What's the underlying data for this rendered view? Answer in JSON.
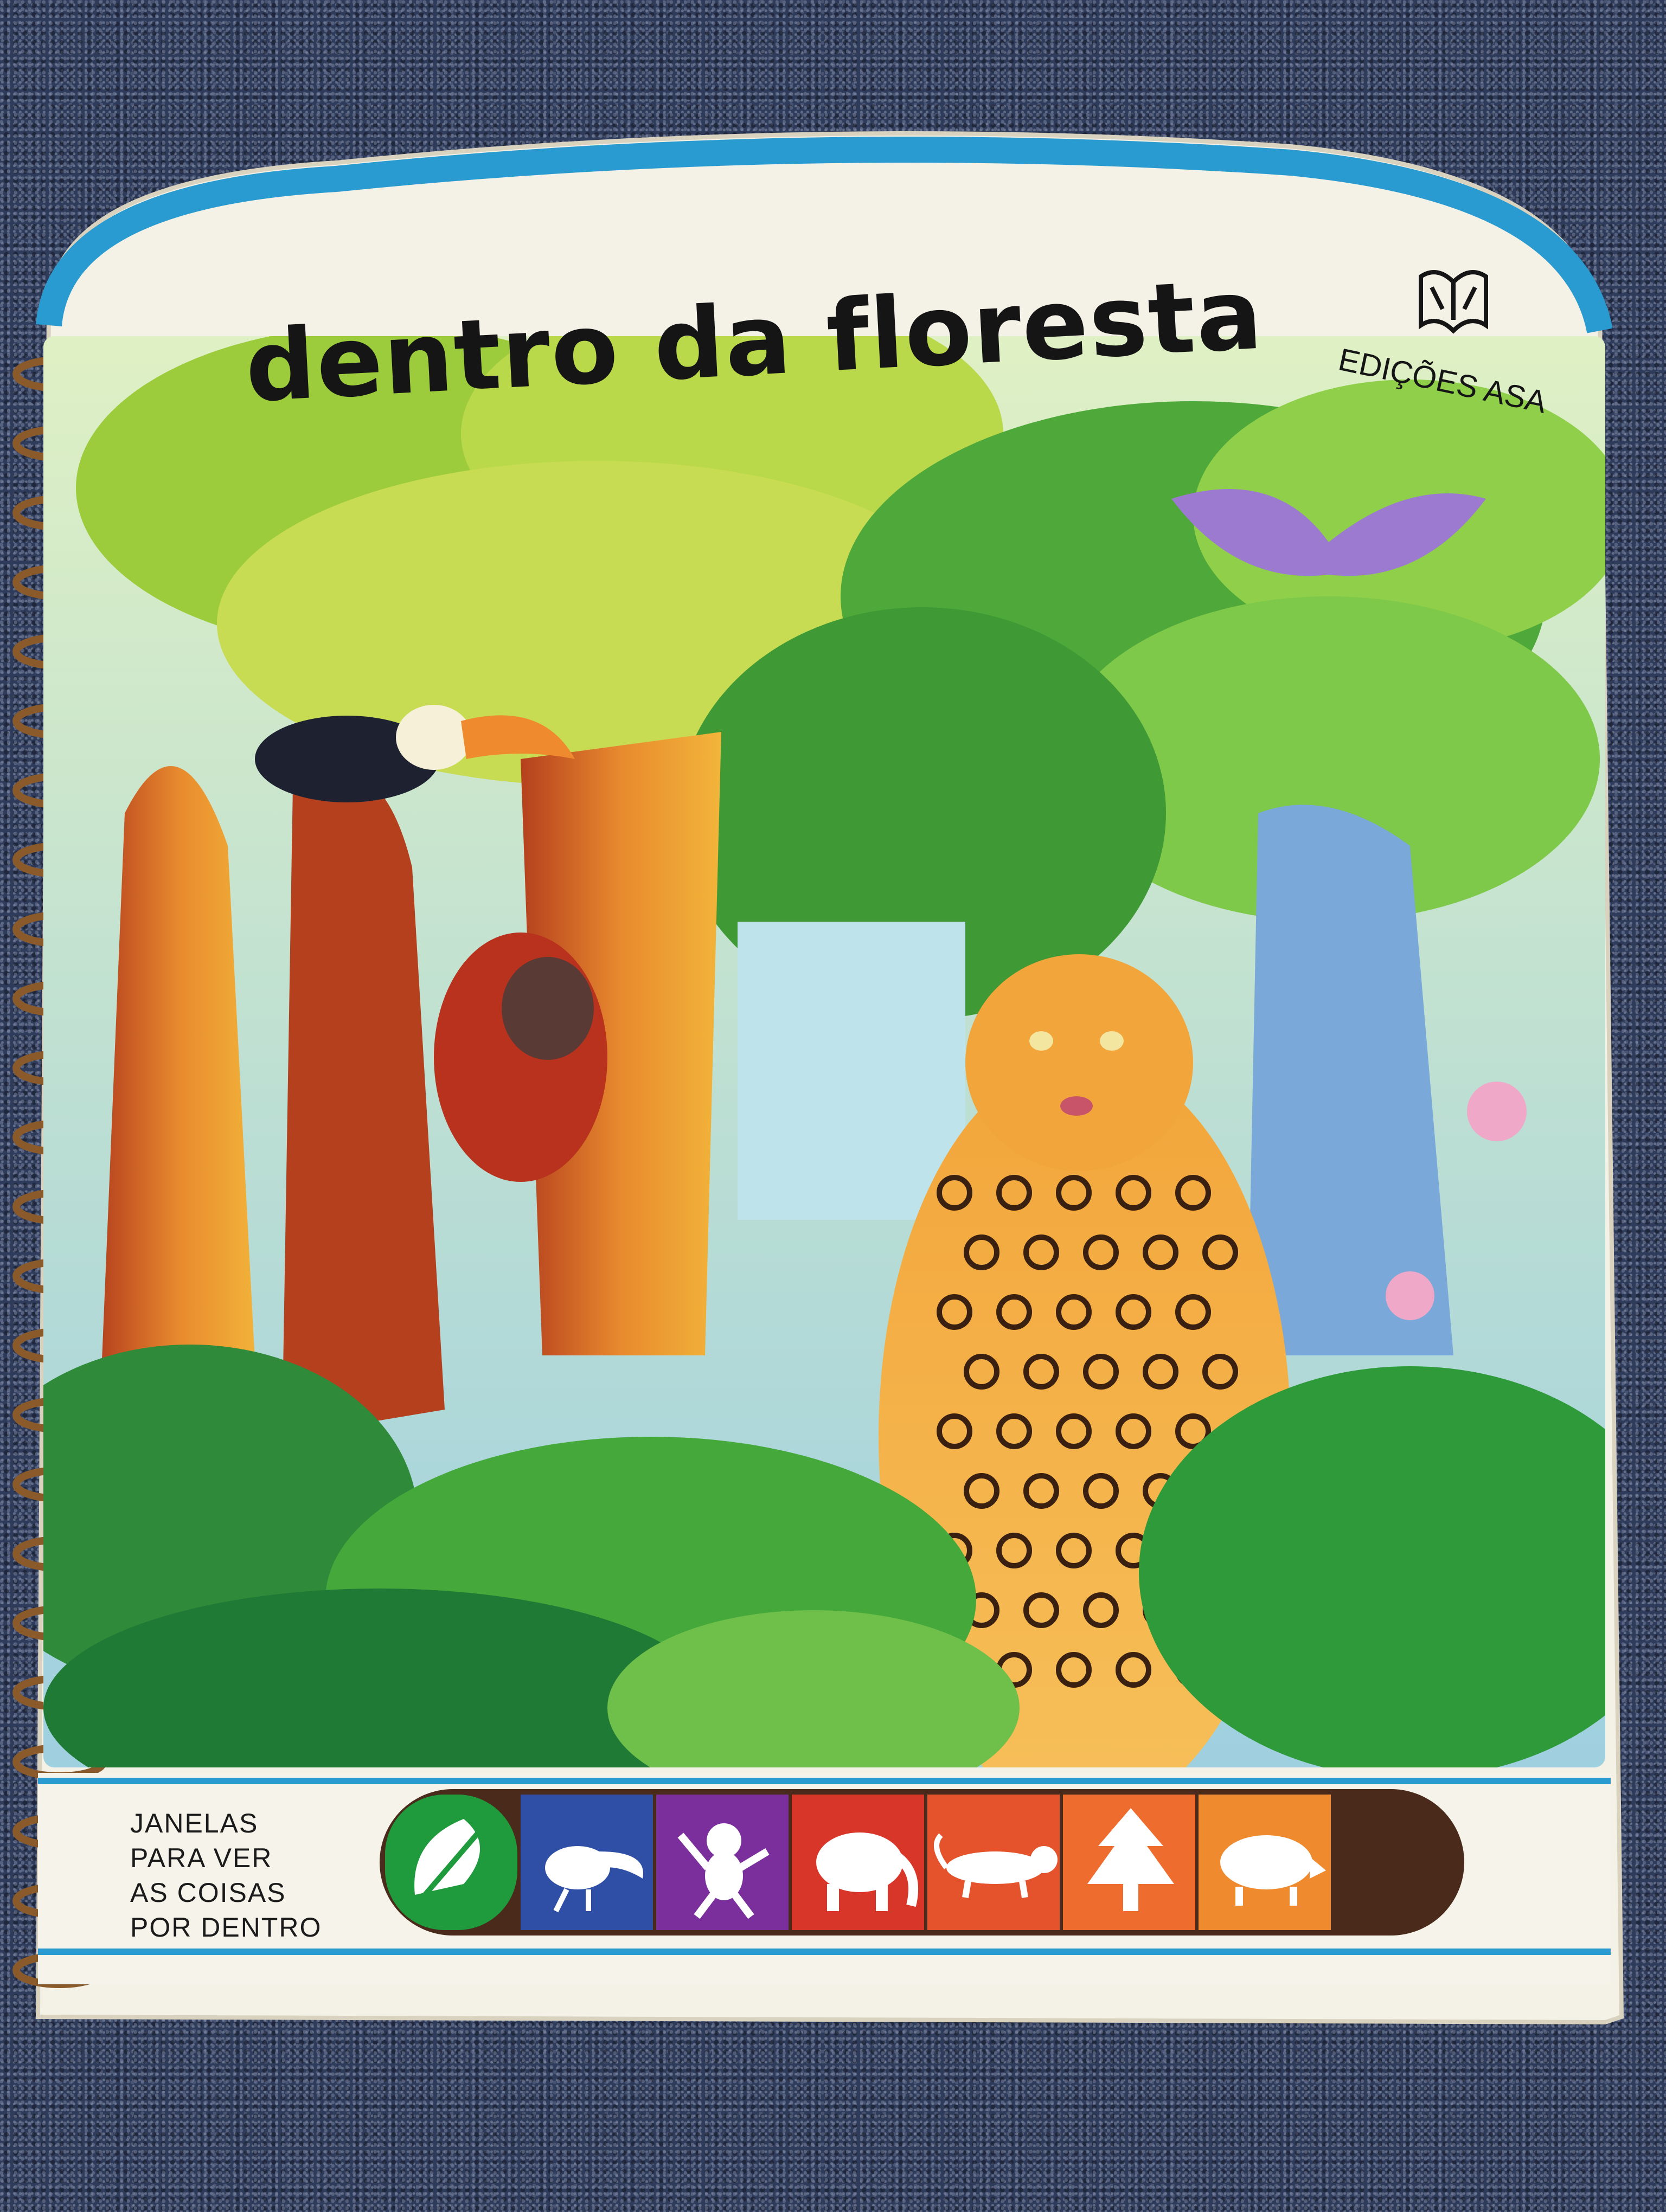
{
  "cover": {
    "title": "dentro da floresta",
    "publisher": "EDIÇÕES ASA",
    "tagline_lines": [
      "JANELAS",
      "PARA VER",
      "AS COISAS",
      "POR DENTRO"
    ]
  },
  "tabs": [
    {
      "icon": "leaf-icon",
      "color": "#1f9a3c"
    },
    {
      "icon": "toucan-icon",
      "color": "#2f4fa6"
    },
    {
      "icon": "monkey-icon",
      "color": "#7a2f9c"
    },
    {
      "icon": "elephant-icon",
      "color": "#d9362a"
    },
    {
      "icon": "tiger-icon",
      "color": "#e4532b"
    },
    {
      "icon": "tree-icon",
      "color": "#ee6c2d"
    },
    {
      "icon": "boar-icon",
      "color": "#f08a2e"
    }
  ],
  "colors": {
    "cover_stripe": "#2a9bd0",
    "foliage": "#5cae2e",
    "carpet": "#2f3b5a"
  }
}
